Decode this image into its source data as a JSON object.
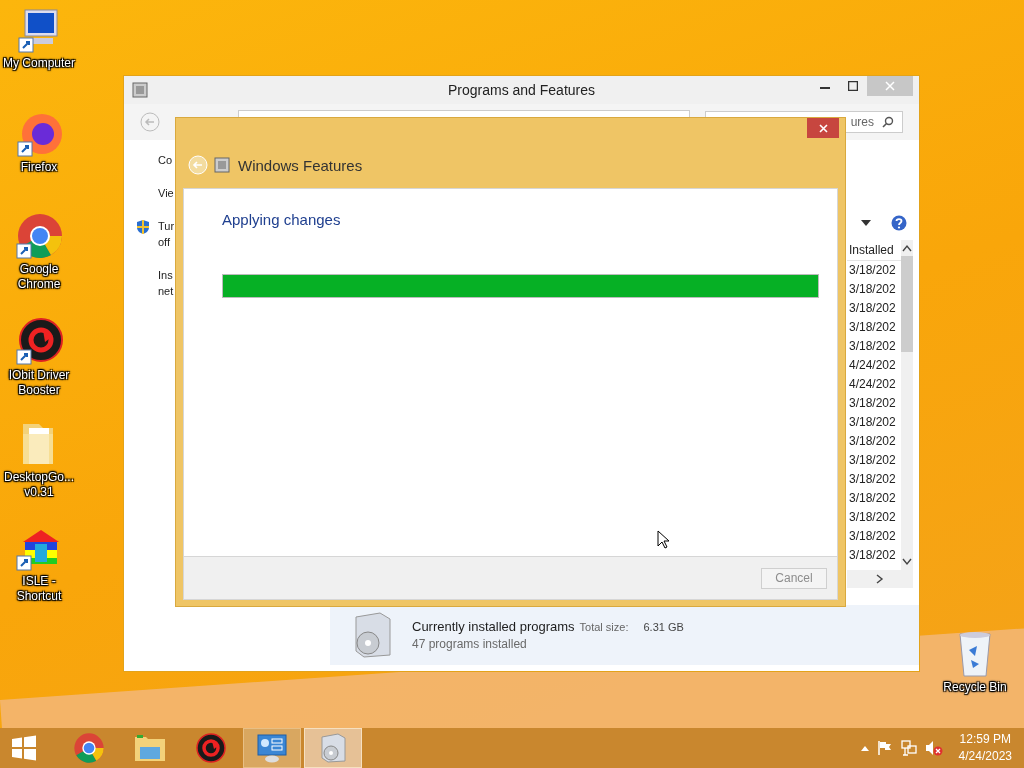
{
  "desktop_icons": [
    {
      "kind": "computer",
      "label": "My Computer"
    },
    {
      "kind": "firefox",
      "label": "Firefox"
    },
    {
      "kind": "chrome",
      "label": "Google Chrome"
    },
    {
      "kind": "driver",
      "label": "IObit Driver Booster"
    },
    {
      "kind": "folder",
      "label": "DesktopGo... v0.31"
    },
    {
      "kind": "house",
      "label": "ISLE - Shortcut"
    }
  ],
  "recycle_bin": {
    "label": "Recycle Bin"
  },
  "main_window": {
    "title": "Programs and Features",
    "search": {
      "placeholder": "ures"
    },
    "sidebar": [
      "Co",
      "Vie",
      "Tur\noff",
      "Ins\nnet"
    ],
    "column": "Installed",
    "dates": [
      "3/18/202",
      "3/18/202",
      "3/18/202",
      "3/18/202",
      "3/18/202",
      "4/24/202",
      "4/24/202",
      "3/18/202",
      "3/18/202",
      "3/18/202",
      "3/18/202",
      "3/18/202",
      "3/18/202",
      "3/18/202",
      "3/18/202",
      "3/18/202"
    ],
    "details": {
      "title": "Currently installed programs",
      "size_label": "Total size:",
      "size": "6.31 GB",
      "count": "47 programs installed"
    }
  },
  "dialog": {
    "title": "Windows Features",
    "heading": "Applying changes",
    "progress": {
      "level": 1.0
    },
    "cancel": {
      "label": "Cancel",
      "disabled": true
    }
  },
  "taskbar": {
    "items": [
      {
        "kind": "chrome",
        "open": false,
        "selected": false
      },
      {
        "kind": "explorer",
        "open": false,
        "selected": false
      },
      {
        "kind": "driver",
        "open": false,
        "selected": false
      },
      {
        "kind": "control",
        "open": true,
        "selected": false
      },
      {
        "kind": "programs",
        "open": true,
        "selected": true
      }
    ],
    "time": "12:59 PM",
    "date": "4/24/2023"
  }
}
